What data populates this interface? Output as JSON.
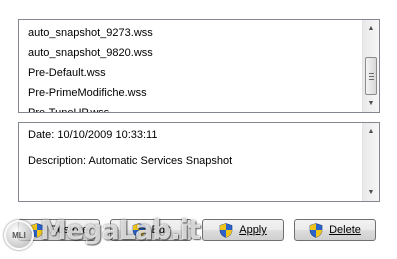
{
  "snapshot_list": {
    "items": [
      "auto_snapshot_9273.wss",
      "auto_snapshot_9820.wss",
      "Pre-Default.wss",
      "Pre-PrimeModifiche.wss",
      "Pre-TuneUP.wss"
    ]
  },
  "details": {
    "date_line": "Date: 10/10/2009 10:33:11",
    "description_line": "Description: Automatic Services Snapshot"
  },
  "buttons": {
    "restore": "Restore",
    "edit": "Edit",
    "apply": "Apply",
    "delete": "Delete"
  },
  "watermark": {
    "text": "MegaLab.it",
    "badge": "MLI"
  },
  "icons": {
    "button_icon": "uac-shield-icon",
    "scroll_up": "scroll-up-arrow-icon",
    "scroll_down": "scroll-down-arrow-icon"
  },
  "colors": {
    "shield_blue": "#2a63c9",
    "shield_yellow": "#f0c419",
    "border": "#828790"
  }
}
